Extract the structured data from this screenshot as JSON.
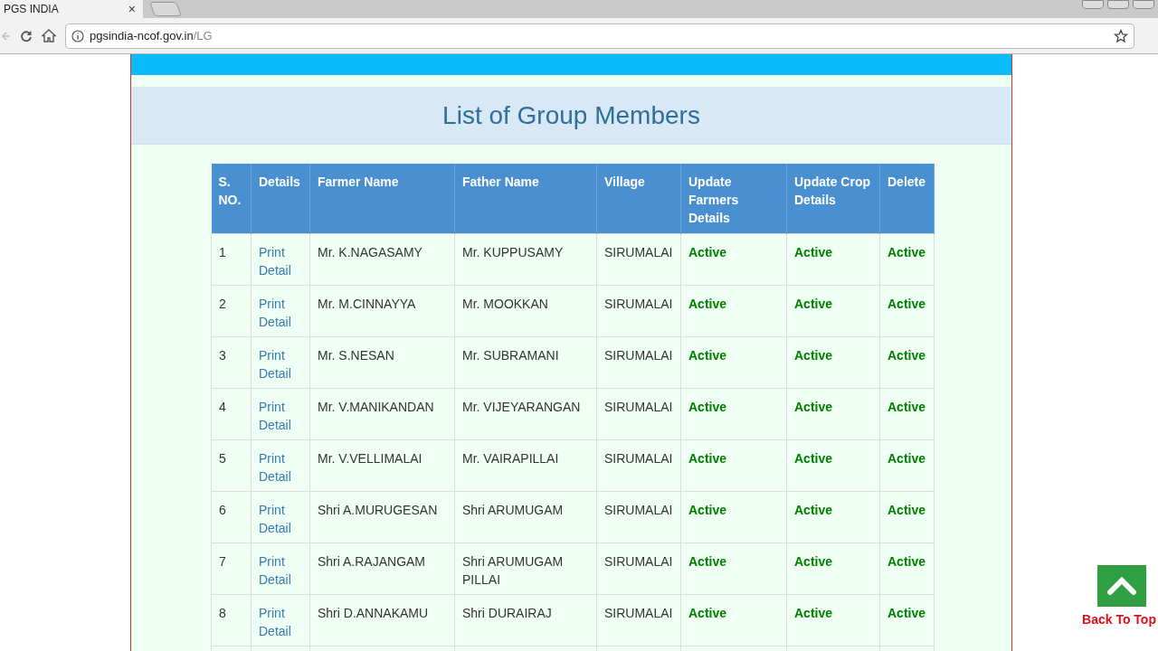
{
  "browser": {
    "tab_title": "PGS INDIA",
    "tab_close": "×",
    "url_host": "pgsindia-ncof.gov.in",
    "url_path": "/LG",
    "back_disabled": true
  },
  "page": {
    "heading": "List of Group Members",
    "table": {
      "columns": [
        "S. NO.",
        "Details",
        "Farmer Name",
        "Father Name",
        "Village",
        "Update Farmers Details",
        "Update Crop Details",
        "Delete"
      ],
      "rows": [
        {
          "sno": "1",
          "details": "Print Detail",
          "farmer": "Mr. K.NAGASAMY",
          "father": "Mr. KUPPUSAMY",
          "village": "SIRUMALAI",
          "update_farmer": "Active",
          "update_crop": "Active",
          "delete": "Active"
        },
        {
          "sno": "2",
          "details": "Print Detail",
          "farmer": "Mr. M.CINNAYYA",
          "father": "Mr. MOOKKAN",
          "village": "SIRUMALAI",
          "update_farmer": "Active",
          "update_crop": "Active",
          "delete": "Active"
        },
        {
          "sno": "3",
          "details": "Print Detail",
          "farmer": "Mr. S.NESAN",
          "father": "Mr. SUBRAMANI",
          "village": "SIRUMALAI",
          "update_farmer": "Active",
          "update_crop": "Active",
          "delete": "Active"
        },
        {
          "sno": "4",
          "details": "Print Detail",
          "farmer": "Mr. V.MANIKANDAN",
          "father": "Mr. VIJEYARANGAN",
          "village": "SIRUMALAI",
          "update_farmer": "Active",
          "update_crop": "Active",
          "delete": "Active"
        },
        {
          "sno": "5",
          "details": "Print Detail",
          "farmer": "Mr. V.VELLIMALAI",
          "father": "Mr. VAIRAPILLAI",
          "village": "SIRUMALAI",
          "update_farmer": "Active",
          "update_crop": "Active",
          "delete": "Active"
        },
        {
          "sno": "6",
          "details": "Print Detail",
          "farmer": "Shri A.MURUGESAN",
          "father": "Shri ARUMUGAM",
          "village": "SIRUMALAI",
          "update_farmer": "Active",
          "update_crop": "Active",
          "delete": "Active"
        },
        {
          "sno": "7",
          "details": "Print Detail",
          "farmer": "Shri A.RAJANGAM",
          "father": "Shri ARUMUGAM PILLAI",
          "village": "SIRUMALAI",
          "update_farmer": "Active",
          "update_crop": "Active",
          "delete": "Active"
        },
        {
          "sno": "8",
          "details": "Print Detail",
          "farmer": "Shri D.ANNAKAMU",
          "father": "Shri DURAIRAJ",
          "village": "SIRUMALAI",
          "update_farmer": "Active",
          "update_crop": "Active",
          "delete": "Active"
        }
      ]
    }
  },
  "back_to_top": {
    "label": "Back To Top"
  }
}
